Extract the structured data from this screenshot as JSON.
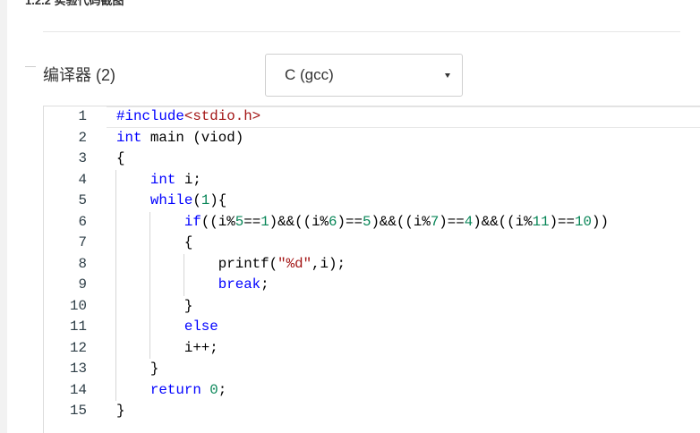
{
  "page": {
    "heading": "1.2.2 实验代码截图"
  },
  "compiler": {
    "label": "编译器 (2)",
    "select": {
      "value": "C (gcc)",
      "icon": "chevron-down-icon"
    }
  },
  "colors": {
    "keyword": "#0000ff",
    "string": "#a31515",
    "number": "#098658",
    "plain": "#000000"
  },
  "code": {
    "active_line": 1,
    "lines": [
      {
        "n": 1,
        "tokens": [
          {
            "t": "#include",
            "k": "keyword"
          },
          {
            "t": "<stdio.h>",
            "k": "string"
          }
        ]
      },
      {
        "n": 2,
        "tokens": [
          {
            "t": "int",
            "k": "keyword"
          },
          {
            "t": " main (viod)",
            "k": "plain"
          }
        ]
      },
      {
        "n": 3,
        "tokens": [
          {
            "t": "{",
            "k": "plain"
          }
        ]
      },
      {
        "n": 4,
        "tokens": [
          {
            "t": "    ",
            "k": "plain"
          },
          {
            "t": "int",
            "k": "keyword"
          },
          {
            "t": " i;",
            "k": "plain"
          }
        ]
      },
      {
        "n": 5,
        "tokens": [
          {
            "t": "    ",
            "k": "plain"
          },
          {
            "t": "while",
            "k": "keyword"
          },
          {
            "t": "(",
            "k": "plain"
          },
          {
            "t": "1",
            "k": "number"
          },
          {
            "t": "){",
            "k": "plain"
          }
        ]
      },
      {
        "n": 6,
        "tokens": [
          {
            "t": "        ",
            "k": "plain"
          },
          {
            "t": "if",
            "k": "keyword"
          },
          {
            "t": "((i%",
            "k": "plain"
          },
          {
            "t": "5",
            "k": "number"
          },
          {
            "t": "==",
            "k": "plain"
          },
          {
            "t": "1",
            "k": "number"
          },
          {
            "t": ")&&((i%",
            "k": "plain"
          },
          {
            "t": "6",
            "k": "number"
          },
          {
            "t": ")==",
            "k": "plain"
          },
          {
            "t": "5",
            "k": "number"
          },
          {
            "t": ")&&((i%",
            "k": "plain"
          },
          {
            "t": "7",
            "k": "number"
          },
          {
            "t": ")==",
            "k": "plain"
          },
          {
            "t": "4",
            "k": "number"
          },
          {
            "t": ")&&((i%",
            "k": "plain"
          },
          {
            "t": "11",
            "k": "number"
          },
          {
            "t": ")==",
            "k": "plain"
          },
          {
            "t": "10",
            "k": "number"
          },
          {
            "t": "))",
            "k": "plain"
          }
        ]
      },
      {
        "n": 7,
        "tokens": [
          {
            "t": "        {",
            "k": "plain"
          }
        ]
      },
      {
        "n": 8,
        "tokens": [
          {
            "t": "            printf(",
            "k": "plain"
          },
          {
            "t": "\"%d\"",
            "k": "string"
          },
          {
            "t": ",i);",
            "k": "plain"
          }
        ]
      },
      {
        "n": 9,
        "tokens": [
          {
            "t": "            ",
            "k": "plain"
          },
          {
            "t": "break",
            "k": "keyword"
          },
          {
            "t": ";",
            "k": "plain"
          }
        ]
      },
      {
        "n": 10,
        "tokens": [
          {
            "t": "        }",
            "k": "plain"
          }
        ]
      },
      {
        "n": 11,
        "tokens": [
          {
            "t": "        ",
            "k": "plain"
          },
          {
            "t": "else",
            "k": "keyword"
          }
        ]
      },
      {
        "n": 12,
        "tokens": [
          {
            "t": "        i++;",
            "k": "plain"
          }
        ]
      },
      {
        "n": 13,
        "tokens": [
          {
            "t": "    }",
            "k": "plain"
          }
        ]
      },
      {
        "n": 14,
        "tokens": [
          {
            "t": "    ",
            "k": "plain"
          },
          {
            "t": "return",
            "k": "keyword"
          },
          {
            "t": " ",
            "k": "plain"
          },
          {
            "t": "0",
            "k": "number"
          },
          {
            "t": ";",
            "k": "plain"
          }
        ]
      },
      {
        "n": 15,
        "tokens": [
          {
            "t": "}",
            "k": "plain"
          }
        ]
      }
    ]
  }
}
